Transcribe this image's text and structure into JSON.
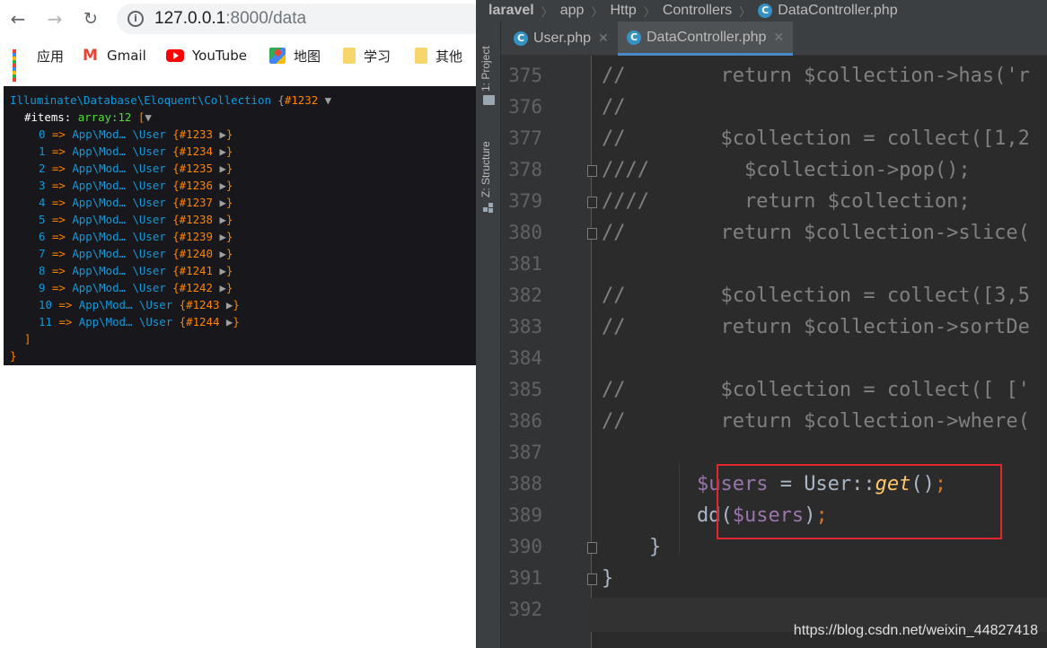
{
  "browser": {
    "url_host": "127.0.0.1",
    "url_rest": ":8000/data",
    "bookmarks": [
      {
        "label": "应用",
        "icon": "apps-grid-icon"
      },
      {
        "label": "Gmail",
        "icon": "gmail-icon"
      },
      {
        "label": "YouTube",
        "icon": "youtube-icon"
      },
      {
        "label": "地图",
        "icon": "maps-icon"
      },
      {
        "label": "学习",
        "icon": "folder-icon"
      },
      {
        "label": "其他",
        "icon": "folder-icon"
      }
    ],
    "dump": {
      "class": "Illuminate\\Database\\Eloquent\\Collection",
      "open_brace": "{",
      "id": "#1232",
      "caret": "▼",
      "items_key": "#items",
      "items_meta": "array:12",
      "items_open": "[",
      "items_caret": "▼",
      "entries": [
        {
          "index": "0",
          "cls": "App\\Mod… \\User",
          "id": "#1233"
        },
        {
          "index": "1",
          "cls": "App\\Mod… \\User",
          "id": "#1234"
        },
        {
          "index": "2",
          "cls": "App\\Mod… \\User",
          "id": "#1235"
        },
        {
          "index": "3",
          "cls": "App\\Mod… \\User",
          "id": "#1236"
        },
        {
          "index": "4",
          "cls": "App\\Mod… \\User",
          "id": "#1237"
        },
        {
          "index": "5",
          "cls": "App\\Mod… \\User",
          "id": "#1238"
        },
        {
          "index": "6",
          "cls": "App\\Mod… \\User",
          "id": "#1239"
        },
        {
          "index": "7",
          "cls": "App\\Mod… \\User",
          "id": "#1240"
        },
        {
          "index": "8",
          "cls": "App\\Mod… \\User",
          "id": "#1241"
        },
        {
          "index": "9",
          "cls": "App\\Mod… \\User",
          "id": "#1242"
        },
        {
          "index": "10",
          "cls": "App\\Mod… \\User",
          "id": "#1243"
        },
        {
          "index": "11",
          "cls": "App\\Mod… \\User",
          "id": "#1244"
        }
      ],
      "items_close": "]",
      "close_brace": "}"
    }
  },
  "ide": {
    "breadcrumbs": [
      "laravel",
      "app",
      "Http",
      "Controllers",
      "DataController.php"
    ],
    "tabs": [
      {
        "label": "User.php",
        "active": false
      },
      {
        "label": "DataController.php",
        "active": true
      }
    ],
    "tool_windows": [
      "1: Project",
      "Z: Structure"
    ],
    "lines": [
      {
        "no": "375",
        "segments": [
          {
            "t": "//        return $collection->has('r",
            "c": "cmt"
          }
        ]
      },
      {
        "no": "376",
        "segments": [
          {
            "t": "//",
            "c": "cmt"
          }
        ]
      },
      {
        "no": "377",
        "segments": [
          {
            "t": "//        $collection = collect([1,2",
            "c": "cmt"
          }
        ]
      },
      {
        "no": "378",
        "segments": [
          {
            "t": "////        $collection->pop();",
            "c": "cmt"
          }
        ]
      },
      {
        "no": "379",
        "segments": [
          {
            "t": "////        return $collection;",
            "c": "cmt"
          }
        ]
      },
      {
        "no": "380",
        "segments": [
          {
            "t": "//        return $collection->slice(",
            "c": "cmt"
          }
        ]
      },
      {
        "no": "381",
        "segments": []
      },
      {
        "no": "382",
        "segments": [
          {
            "t": "//        $collection = collect([3,5",
            "c": "cmt"
          }
        ]
      },
      {
        "no": "383",
        "segments": [
          {
            "t": "//        return $collection->sortDe",
            "c": "cmt"
          }
        ]
      },
      {
        "no": "384",
        "segments": []
      },
      {
        "no": "385",
        "segments": [
          {
            "t": "//        $collection = collect([ ['",
            "c": "cmt"
          }
        ]
      },
      {
        "no": "386",
        "segments": [
          {
            "t": "//        return $collection->where(",
            "c": "cmt"
          }
        ]
      },
      {
        "no": "387",
        "segments": []
      },
      {
        "no": "388",
        "segments": [
          {
            "t": "        ",
            "c": ""
          },
          {
            "t": "$users",
            "c": "var"
          },
          {
            "t": " = User::",
            "c": ""
          },
          {
            "t": "get",
            "c": "fn"
          },
          {
            "t": "()",
            "c": ""
          },
          {
            "t": ";",
            "c": "punct"
          }
        ]
      },
      {
        "no": "389",
        "segments": [
          {
            "t": "        dd(",
            "c": ""
          },
          {
            "t": "$users",
            "c": "var"
          },
          {
            "t": ")",
            "c": ""
          },
          {
            "t": ";",
            "c": "punct"
          }
        ]
      },
      {
        "no": "390",
        "segments": [
          {
            "t": "    }",
            "c": ""
          }
        ]
      },
      {
        "no": "391",
        "segments": [
          {
            "t": "}",
            "c": ""
          }
        ]
      },
      {
        "no": "392",
        "segments": []
      }
    ]
  },
  "watermark": "https://blog.csdn.net/weixin_44827418"
}
